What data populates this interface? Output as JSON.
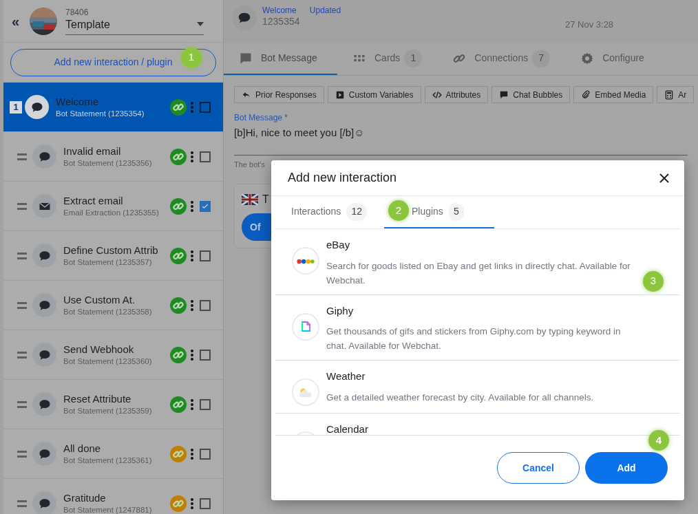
{
  "sidebar": {
    "collapse": "«",
    "bot_id": "78406",
    "bot_name": "Template",
    "add_button": {
      "label": "Add new interaction / plugin",
      "marker": "1"
    },
    "items": [
      {
        "title": "Welcome",
        "subtitle": "Bot Statement (1235354)",
        "index": "1",
        "kind": "chat",
        "color": "#1f8a24",
        "checked": false,
        "selected": true
      },
      {
        "title": "Invalid email",
        "subtitle": "Bot Statement (1235356)",
        "kind": "chat",
        "color": "#1f8a24",
        "checked": false,
        "selected": false
      },
      {
        "title": "Extract email",
        "subtitle": "Email Extraction (1235355)",
        "kind": "mail",
        "color": "#1f8a24",
        "checked": true,
        "selected": false
      },
      {
        "title": "Define Custom Attrib",
        "subtitle": "Bot Statement (1235357)",
        "kind": "chat",
        "color": "#1f8a24",
        "checked": false,
        "selected": false
      },
      {
        "title": "Use Custom At.",
        "subtitle": "Bot Statement (1235358)",
        "kind": "chat",
        "color": "#1f8a24",
        "checked": false,
        "selected": false
      },
      {
        "title": "Send Webhook",
        "subtitle": "Bot Statement (1235360)",
        "kind": "chat",
        "color": "#1f8a24",
        "checked": false,
        "selected": false
      },
      {
        "title": "Reset Attribute",
        "subtitle": "Bot Statement (1235359)",
        "kind": "chat",
        "color": "#1f8a24",
        "checked": false,
        "selected": false
      },
      {
        "title": "All done",
        "subtitle": "Bot Statement (1235361)",
        "kind": "chat",
        "color": "#c07f00",
        "checked": false,
        "selected": false
      },
      {
        "title": "Gratitude",
        "subtitle": "Bot Statement (1247881)",
        "kind": "chat",
        "color": "#c07f00",
        "checked": false,
        "selected": false
      }
    ]
  },
  "header": {
    "name": "Welcome",
    "status": "Updated",
    "id": "1235354",
    "date": "27 Nov 3:28"
  },
  "tabs": [
    {
      "label": "Bot Message",
      "kind": "message",
      "selected": true
    },
    {
      "label": "Cards",
      "kind": "grid",
      "count": "1",
      "selected": false
    },
    {
      "label": "Connections",
      "kind": "link",
      "count": "7",
      "selected": false
    },
    {
      "label": "Configure",
      "kind": "gear",
      "selected": false
    }
  ],
  "toolbar": [
    {
      "label": "Prior Responses",
      "kind": "reply"
    },
    {
      "label": "Custom Variables",
      "kind": "play"
    },
    {
      "label": "Attributes",
      "kind": "code"
    },
    {
      "label": "Chat Bubbles",
      "kind": "bubble"
    },
    {
      "label": "Embed Media",
      "kind": "clip"
    },
    {
      "label": "Ar",
      "kind": "calc"
    }
  ],
  "message_field": {
    "label": "Bot Message *",
    "value": "[b]Hi, nice to meet you [/b]☺",
    "helper": "The bot's"
  },
  "card": {
    "title": "T",
    "button": "Of"
  },
  "dialog": {
    "title": "Add new interaction",
    "tabs": [
      {
        "label": "Interactions",
        "count": "12",
        "selected": false
      },
      {
        "label": "Plugins",
        "count": "5",
        "selected": true,
        "marker": "2"
      }
    ],
    "plugins": [
      {
        "name": "eBay",
        "description": "Search for goods listed on Ebay and get links in directly chat. Available for Webchat.",
        "kind": "ebay",
        "marker": "3"
      },
      {
        "name": "Giphy",
        "description": "Get thousands of gifs and stickers from Giphy.com by typing keyword in chat. Available for Webchat.",
        "kind": "giphy"
      },
      {
        "name": "Weather",
        "description": "Get a detailed weather forecast by city. Available for all channels.",
        "kind": "weather"
      },
      {
        "name": "Calendar",
        "kind": "calendar"
      }
    ],
    "cancel": "Cancel",
    "add": {
      "label": "Add",
      "marker": "4"
    }
  }
}
